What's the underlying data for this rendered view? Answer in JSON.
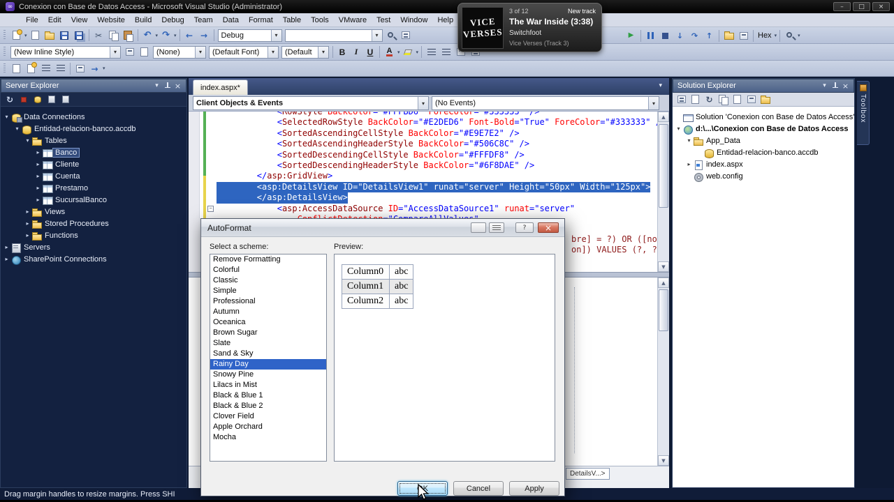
{
  "window": {
    "title": "Conexion con Base de Datos Access - Microsoft Visual Studio (Administrator)"
  },
  "menu": [
    "File",
    "Edit",
    "View",
    "Website",
    "Build",
    "Debug",
    "Team",
    "Data",
    "Format",
    "Table",
    "Tools",
    "VMware",
    "Test",
    "Window",
    "Help"
  ],
  "toolbar1": {
    "configuration": "Debug",
    "hex": "Hex"
  },
  "toolbar2": {
    "style_combo": "(New Inline Style)",
    "target_rule_combo": "(None)",
    "font_combo": "(Default Font)",
    "size_combo": "(Default",
    "bold": "B",
    "italic": "I",
    "underline": "U",
    "foreground": "A"
  },
  "music_overlay": {
    "track_position": "3 of 12",
    "status": "New track",
    "title": "The War Inside (3:38)",
    "artist": "Switchfoot",
    "album": "Vice Verses (Track 3)",
    "art_line1": "VICE",
    "art_line2": "VERSES"
  },
  "server_explorer": {
    "title": "Server Explorer",
    "tree": [
      {
        "label": "Data Connections",
        "level": 0,
        "expand": "open",
        "icon": "data-connections"
      },
      {
        "label": "Entidad-relacion-banco.accdb",
        "level": 1,
        "expand": "open",
        "icon": "database"
      },
      {
        "label": "Tables",
        "level": 2,
        "expand": "open",
        "icon": "folder"
      },
      {
        "label": "Banco",
        "level": 3,
        "expand": "closed",
        "icon": "table",
        "selected": true
      },
      {
        "label": "Cliente",
        "level": 3,
        "expand": "closed",
        "icon": "table"
      },
      {
        "label": "Cuenta",
        "level": 3,
        "expand": "closed",
        "icon": "table"
      },
      {
        "label": "Prestamo",
        "level": 3,
        "expand": "closed",
        "icon": "table"
      },
      {
        "label": "SucursalBanco",
        "level": 3,
        "expand": "closed",
        "icon": "table"
      },
      {
        "label": "Views",
        "level": 2,
        "expand": "closed",
        "icon": "folder"
      },
      {
        "label": "Stored Procedures",
        "level": 2,
        "expand": "closed",
        "icon": "folder"
      },
      {
        "label": "Functions",
        "level": 2,
        "expand": "closed",
        "icon": "folder"
      },
      {
        "label": "Servers",
        "level": 0,
        "expand": "closed",
        "icon": "server"
      },
      {
        "label": "SharePoint Connections",
        "level": 0,
        "expand": "closed",
        "icon": "sharepoint"
      }
    ]
  },
  "editor": {
    "tab_label": "index.aspx*",
    "object_dropdown": "Client Objects & Events",
    "event_dropdown": "(No Events)",
    "tag_navigator": "DetailsV...>",
    "hidden_line_fragments": [
      "bre] = ?) OR ([nomb",
      "on]) VALUES (?, ?,"
    ],
    "code_lines": [
      {
        "sel": false,
        "tokens": [
          [
            "p",
            "            "
          ],
          [
            "d",
            "<"
          ],
          [
            "n",
            "RowStyle"
          ],
          [
            "p",
            " "
          ],
          [
            "a",
            "BackColor"
          ],
          [
            "d",
            "="
          ],
          [
            "v",
            "\"#FFFBD6\""
          ],
          [
            "p",
            " "
          ],
          [
            "a",
            "ForeColor"
          ],
          [
            "d",
            "="
          ],
          [
            "v",
            "\"#333333\""
          ],
          [
            "p",
            " "
          ],
          [
            "d",
            "/>"
          ]
        ]
      },
      {
        "sel": false,
        "tokens": [
          [
            "p",
            "            "
          ],
          [
            "d",
            "<"
          ],
          [
            "n",
            "SelectedRowStyle"
          ],
          [
            "p",
            " "
          ],
          [
            "a",
            "BackColor"
          ],
          [
            "d",
            "="
          ],
          [
            "v",
            "\"#E2DED6\""
          ],
          [
            "p",
            " "
          ],
          [
            "a",
            "Font-Bold"
          ],
          [
            "d",
            "="
          ],
          [
            "v",
            "\"True\""
          ],
          [
            "p",
            " "
          ],
          [
            "a",
            "ForeColor"
          ],
          [
            "d",
            "="
          ],
          [
            "v",
            "\"#333333\""
          ],
          [
            "p",
            " "
          ],
          [
            "d",
            "/>"
          ]
        ]
      },
      {
        "sel": false,
        "tokens": [
          [
            "p",
            "            "
          ],
          [
            "d",
            "<"
          ],
          [
            "n",
            "SortedAscendingCellStyle"
          ],
          [
            "p",
            " "
          ],
          [
            "a",
            "BackColor"
          ],
          [
            "d",
            "="
          ],
          [
            "v",
            "\"#E9E7E2\""
          ],
          [
            "p",
            " "
          ],
          [
            "d",
            "/>"
          ]
        ]
      },
      {
        "sel": false,
        "tokens": [
          [
            "p",
            "            "
          ],
          [
            "d",
            "<"
          ],
          [
            "n",
            "SortedAscendingHeaderStyle"
          ],
          [
            "p",
            " "
          ],
          [
            "a",
            "BackColor"
          ],
          [
            "d",
            "="
          ],
          [
            "v",
            "\"#506C8C\""
          ],
          [
            "p",
            " "
          ],
          [
            "d",
            "/>"
          ]
        ]
      },
      {
        "sel": false,
        "tokens": [
          [
            "p",
            "            "
          ],
          [
            "d",
            "<"
          ],
          [
            "n",
            "SortedDescendingCellStyle"
          ],
          [
            "p",
            " "
          ],
          [
            "a",
            "BackColor"
          ],
          [
            "d",
            "="
          ],
          [
            "v",
            "\"#FFFDF8\""
          ],
          [
            "p",
            " "
          ],
          [
            "d",
            "/>"
          ]
        ]
      },
      {
        "sel": false,
        "tokens": [
          [
            "p",
            "            "
          ],
          [
            "d",
            "<"
          ],
          [
            "n",
            "SortedDescendingHeaderStyle"
          ],
          [
            "p",
            " "
          ],
          [
            "a",
            "BackColor"
          ],
          [
            "d",
            "="
          ],
          [
            "v",
            "\"#6F8DAE\""
          ],
          [
            "p",
            " "
          ],
          [
            "d",
            "/>"
          ]
        ]
      },
      {
        "sel": false,
        "tokens": [
          [
            "p",
            "        "
          ],
          [
            "d",
            "</"
          ],
          [
            "n",
            "asp:GridView"
          ],
          [
            "d",
            ">"
          ]
        ]
      },
      {
        "sel": true,
        "tokens": [
          [
            "p",
            "        "
          ],
          [
            "d",
            "<"
          ],
          [
            "n",
            "asp:DetailsView"
          ],
          [
            "p",
            " "
          ],
          [
            "a",
            "ID"
          ],
          [
            "d",
            "="
          ],
          [
            "v",
            "\"DetailsView1\""
          ],
          [
            "p",
            " "
          ],
          [
            "a",
            "runat"
          ],
          [
            "d",
            "="
          ],
          [
            "v",
            "\"server\""
          ],
          [
            "p",
            " "
          ],
          [
            "a",
            "Height"
          ],
          [
            "d",
            "="
          ],
          [
            "v",
            "\"50px\""
          ],
          [
            "p",
            " "
          ],
          [
            "a",
            "Width"
          ],
          [
            "d",
            "="
          ],
          [
            "v",
            "\"125px\""
          ],
          [
            "d",
            ">"
          ]
        ]
      },
      {
        "sel": true,
        "tokens": [
          [
            "p",
            "        "
          ],
          [
            "d",
            "</"
          ],
          [
            "n",
            "asp:DetailsView"
          ],
          [
            "d",
            ">"
          ]
        ]
      },
      {
        "sel": false,
        "tokens": [
          [
            "p",
            "            "
          ],
          [
            "d",
            "<"
          ],
          [
            "n",
            "asp:AccessDataSource"
          ],
          [
            "p",
            " "
          ],
          [
            "a",
            "ID"
          ],
          [
            "d",
            "="
          ],
          [
            "v",
            "\"AccessDataSource1\""
          ],
          [
            "p",
            " "
          ],
          [
            "a",
            "runat"
          ],
          [
            "d",
            "="
          ],
          [
            "v",
            "\"server\""
          ]
        ]
      },
      {
        "sel": false,
        "tokens": [
          [
            "p",
            "                "
          ],
          [
            "a",
            "ConflictDetection"
          ],
          [
            "d",
            "="
          ],
          [
            "v",
            "\"CompareAllValues\""
          ]
        ]
      }
    ]
  },
  "solution_explorer": {
    "title": "Solution Explorer",
    "tree": [
      {
        "label": "Solution 'Conexion con Base de Datos Access'",
        "level": 0,
        "icon": "solution"
      },
      {
        "label": "d:\\...\\Conexion con Base de Datos Access",
        "level": 0,
        "expand": "open",
        "icon": "project",
        "bold": true
      },
      {
        "label": "App_Data",
        "level": 1,
        "expand": "open",
        "icon": "folder"
      },
      {
        "label": "Entidad-relacion-banco.accdb",
        "level": 2,
        "icon": "database"
      },
      {
        "label": "index.aspx",
        "level": 1,
        "expand": "closed",
        "icon": "aspx"
      },
      {
        "label": "web.config",
        "level": 1,
        "icon": "config"
      }
    ]
  },
  "toolbox": {
    "label": "Toolbox"
  },
  "dialog": {
    "title": "AutoFormat",
    "scheme_label": "Select a scheme:",
    "preview_label": "Preview:",
    "schemes": [
      "Remove Formatting",
      "Colorful",
      "Classic",
      "Simple",
      "Professional",
      "Autumn",
      "Oceanica",
      "Brown Sugar",
      "Slate",
      "Sand & Sky",
      "Rainy Day",
      "Snowy Pine",
      "Lilacs in Mist",
      "Black & Blue 1",
      "Black & Blue 2",
      "Clover Field",
      "Apple Orchard",
      "Mocha"
    ],
    "selected_scheme": "Rainy Day",
    "preview_rows": [
      [
        "Column0",
        "abc"
      ],
      [
        "Column1",
        "abc"
      ],
      [
        "Column2",
        "abc"
      ]
    ],
    "ok": "OK",
    "cancel": "Cancel",
    "apply": "Apply"
  },
  "status_bar": {
    "message": "Drag margin handles to resize margins. Press SHI"
  }
}
